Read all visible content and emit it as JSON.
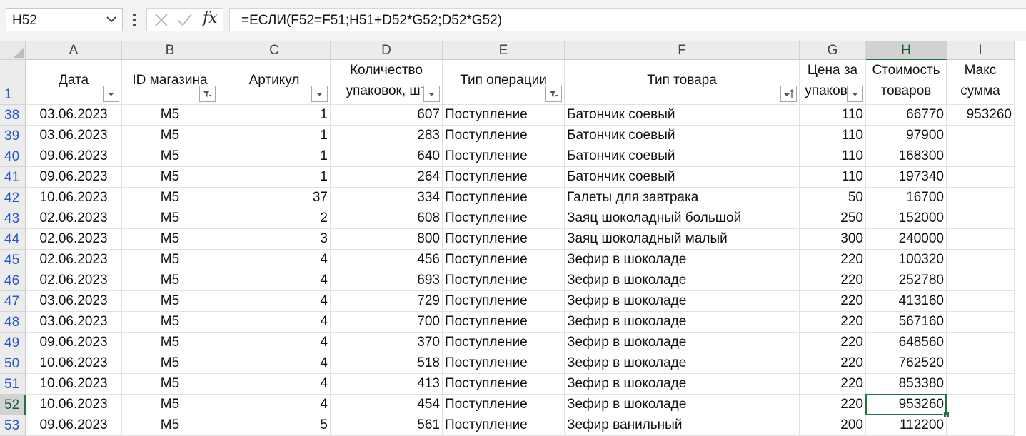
{
  "name_box": "H52",
  "formula": "=ЕСЛИ(F52=F51;H51+D52*G52;D52*G52)",
  "accent": "#217346",
  "columns": [
    "A",
    "B",
    "C",
    "D",
    "E",
    "F",
    "G",
    "H",
    "I"
  ],
  "header_row_number": "1",
  "headers": [
    {
      "line1": "Дата",
      "line2": "",
      "filter": "dropdown"
    },
    {
      "line1": "ID магазина",
      "line2": "",
      "filter": "filtered"
    },
    {
      "line1": "Артикул",
      "line2": "",
      "filter": "dropdown"
    },
    {
      "line1": "Количество",
      "line2": "упаковок, шт",
      "filter": "dropdown"
    },
    {
      "line1": "Тип операции",
      "line2": "",
      "filter": "filtered"
    },
    {
      "line1": "Тип товара",
      "line2": "",
      "filter": "sorted-asc"
    },
    {
      "line1": "Цена за",
      "line2": "упаковку",
      "filter": "dropdown"
    },
    {
      "line1": "Стоимость",
      "line2": "товаров",
      "filter": "none"
    },
    {
      "line1": "Макс",
      "line2": "сумма",
      "filter": "none"
    }
  ],
  "rows": [
    {
      "n": "38",
      "cells": [
        "03.06.2023",
        "M5",
        "1",
        "607",
        "Поступление",
        "Батончик соевый",
        "110",
        "66770",
        "953260"
      ]
    },
    {
      "n": "39",
      "cells": [
        "03.06.2023",
        "M5",
        "1",
        "283",
        "Поступление",
        "Батончик соевый",
        "110",
        "97900",
        ""
      ]
    },
    {
      "n": "40",
      "cells": [
        "09.06.2023",
        "M5",
        "1",
        "640",
        "Поступление",
        "Батончик соевый",
        "110",
        "168300",
        ""
      ]
    },
    {
      "n": "41",
      "cells": [
        "09.06.2023",
        "M5",
        "1",
        "264",
        "Поступление",
        "Батончик соевый",
        "110",
        "197340",
        ""
      ]
    },
    {
      "n": "42",
      "cells": [
        "10.06.2023",
        "M5",
        "37",
        "334",
        "Поступление",
        "Галеты для завтрака",
        "50",
        "16700",
        ""
      ]
    },
    {
      "n": "43",
      "cells": [
        "02.06.2023",
        "M5",
        "2",
        "608",
        "Поступление",
        "Заяц шоколадный большой",
        "250",
        "152000",
        ""
      ]
    },
    {
      "n": "44",
      "cells": [
        "02.06.2023",
        "M5",
        "3",
        "800",
        "Поступление",
        "Заяц шоколадный малый",
        "300",
        "240000",
        ""
      ]
    },
    {
      "n": "45",
      "cells": [
        "02.06.2023",
        "M5",
        "4",
        "456",
        "Поступление",
        "Зефир в шоколаде",
        "220",
        "100320",
        ""
      ]
    },
    {
      "n": "46",
      "cells": [
        "02.06.2023",
        "M5",
        "4",
        "693",
        "Поступление",
        "Зефир в шоколаде",
        "220",
        "252780",
        ""
      ]
    },
    {
      "n": "47",
      "cells": [
        "03.06.2023",
        "M5",
        "4",
        "729",
        "Поступление",
        "Зефир в шоколаде",
        "220",
        "413160",
        ""
      ]
    },
    {
      "n": "48",
      "cells": [
        "03.06.2023",
        "M5",
        "4",
        "700",
        "Поступление",
        "Зефир в шоколаде",
        "220",
        "567160",
        ""
      ]
    },
    {
      "n": "49",
      "cells": [
        "09.06.2023",
        "M5",
        "4",
        "370",
        "Поступление",
        "Зефир в шоколаде",
        "220",
        "648560",
        ""
      ]
    },
    {
      "n": "50",
      "cells": [
        "10.06.2023",
        "M5",
        "4",
        "518",
        "Поступление",
        "Зефир в шоколаде",
        "220",
        "762520",
        ""
      ]
    },
    {
      "n": "51",
      "cells": [
        "10.06.2023",
        "M5",
        "4",
        "413",
        "Поступление",
        "Зефир в шоколаде",
        "220",
        "853380",
        ""
      ]
    },
    {
      "n": "52",
      "cells": [
        "10.06.2023",
        "M5",
        "4",
        "454",
        "Поступление",
        "Зефир в шоколаде",
        "220",
        "953260",
        ""
      ]
    },
    {
      "n": "53",
      "cells": [
        "09.06.2023",
        "M5",
        "5",
        "561",
        "Поступление",
        "Зефир ванильный",
        "200",
        "112200",
        ""
      ]
    }
  ],
  "selected_row": "52",
  "selected_col": "H"
}
